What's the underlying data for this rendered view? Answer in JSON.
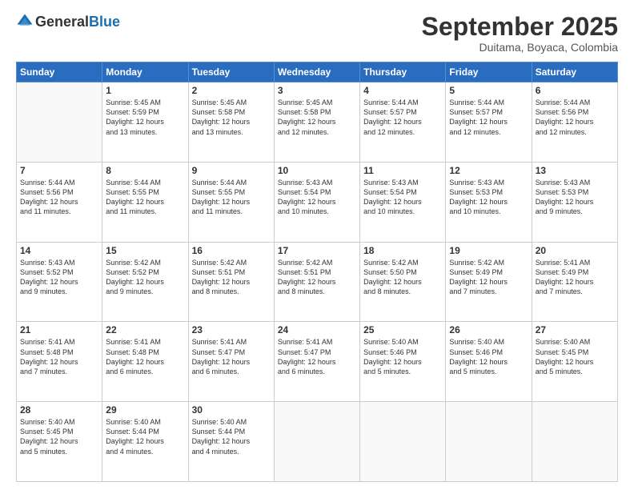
{
  "header": {
    "logo_general": "General",
    "logo_blue": "Blue",
    "month_title": "September 2025",
    "location": "Duitama, Boyaca, Colombia"
  },
  "weekdays": [
    "Sunday",
    "Monday",
    "Tuesday",
    "Wednesday",
    "Thursday",
    "Friday",
    "Saturday"
  ],
  "weeks": [
    [
      {
        "day": "",
        "info": ""
      },
      {
        "day": "1",
        "info": "Sunrise: 5:45 AM\nSunset: 5:59 PM\nDaylight: 12 hours\nand 13 minutes."
      },
      {
        "day": "2",
        "info": "Sunrise: 5:45 AM\nSunset: 5:58 PM\nDaylight: 12 hours\nand 13 minutes."
      },
      {
        "day": "3",
        "info": "Sunrise: 5:45 AM\nSunset: 5:58 PM\nDaylight: 12 hours\nand 12 minutes."
      },
      {
        "day": "4",
        "info": "Sunrise: 5:44 AM\nSunset: 5:57 PM\nDaylight: 12 hours\nand 12 minutes."
      },
      {
        "day": "5",
        "info": "Sunrise: 5:44 AM\nSunset: 5:57 PM\nDaylight: 12 hours\nand 12 minutes."
      },
      {
        "day": "6",
        "info": "Sunrise: 5:44 AM\nSunset: 5:56 PM\nDaylight: 12 hours\nand 12 minutes."
      }
    ],
    [
      {
        "day": "7",
        "info": "Sunrise: 5:44 AM\nSunset: 5:56 PM\nDaylight: 12 hours\nand 11 minutes."
      },
      {
        "day": "8",
        "info": "Sunrise: 5:44 AM\nSunset: 5:55 PM\nDaylight: 12 hours\nand 11 minutes."
      },
      {
        "day": "9",
        "info": "Sunrise: 5:44 AM\nSunset: 5:55 PM\nDaylight: 12 hours\nand 11 minutes."
      },
      {
        "day": "10",
        "info": "Sunrise: 5:43 AM\nSunset: 5:54 PM\nDaylight: 12 hours\nand 10 minutes."
      },
      {
        "day": "11",
        "info": "Sunrise: 5:43 AM\nSunset: 5:54 PM\nDaylight: 12 hours\nand 10 minutes."
      },
      {
        "day": "12",
        "info": "Sunrise: 5:43 AM\nSunset: 5:53 PM\nDaylight: 12 hours\nand 10 minutes."
      },
      {
        "day": "13",
        "info": "Sunrise: 5:43 AM\nSunset: 5:53 PM\nDaylight: 12 hours\nand 9 minutes."
      }
    ],
    [
      {
        "day": "14",
        "info": "Sunrise: 5:43 AM\nSunset: 5:52 PM\nDaylight: 12 hours\nand 9 minutes."
      },
      {
        "day": "15",
        "info": "Sunrise: 5:42 AM\nSunset: 5:52 PM\nDaylight: 12 hours\nand 9 minutes."
      },
      {
        "day": "16",
        "info": "Sunrise: 5:42 AM\nSunset: 5:51 PM\nDaylight: 12 hours\nand 8 minutes."
      },
      {
        "day": "17",
        "info": "Sunrise: 5:42 AM\nSunset: 5:51 PM\nDaylight: 12 hours\nand 8 minutes."
      },
      {
        "day": "18",
        "info": "Sunrise: 5:42 AM\nSunset: 5:50 PM\nDaylight: 12 hours\nand 8 minutes."
      },
      {
        "day": "19",
        "info": "Sunrise: 5:42 AM\nSunset: 5:49 PM\nDaylight: 12 hours\nand 7 minutes."
      },
      {
        "day": "20",
        "info": "Sunrise: 5:41 AM\nSunset: 5:49 PM\nDaylight: 12 hours\nand 7 minutes."
      }
    ],
    [
      {
        "day": "21",
        "info": "Sunrise: 5:41 AM\nSunset: 5:48 PM\nDaylight: 12 hours\nand 7 minutes."
      },
      {
        "day": "22",
        "info": "Sunrise: 5:41 AM\nSunset: 5:48 PM\nDaylight: 12 hours\nand 6 minutes."
      },
      {
        "day": "23",
        "info": "Sunrise: 5:41 AM\nSunset: 5:47 PM\nDaylight: 12 hours\nand 6 minutes."
      },
      {
        "day": "24",
        "info": "Sunrise: 5:41 AM\nSunset: 5:47 PM\nDaylight: 12 hours\nand 6 minutes."
      },
      {
        "day": "25",
        "info": "Sunrise: 5:40 AM\nSunset: 5:46 PM\nDaylight: 12 hours\nand 5 minutes."
      },
      {
        "day": "26",
        "info": "Sunrise: 5:40 AM\nSunset: 5:46 PM\nDaylight: 12 hours\nand 5 minutes."
      },
      {
        "day": "27",
        "info": "Sunrise: 5:40 AM\nSunset: 5:45 PM\nDaylight: 12 hours\nand 5 minutes."
      }
    ],
    [
      {
        "day": "28",
        "info": "Sunrise: 5:40 AM\nSunset: 5:45 PM\nDaylight: 12 hours\nand 5 minutes."
      },
      {
        "day": "29",
        "info": "Sunrise: 5:40 AM\nSunset: 5:44 PM\nDaylight: 12 hours\nand 4 minutes."
      },
      {
        "day": "30",
        "info": "Sunrise: 5:40 AM\nSunset: 5:44 PM\nDaylight: 12 hours\nand 4 minutes."
      },
      {
        "day": "",
        "info": ""
      },
      {
        "day": "",
        "info": ""
      },
      {
        "day": "",
        "info": ""
      },
      {
        "day": "",
        "info": ""
      }
    ]
  ]
}
